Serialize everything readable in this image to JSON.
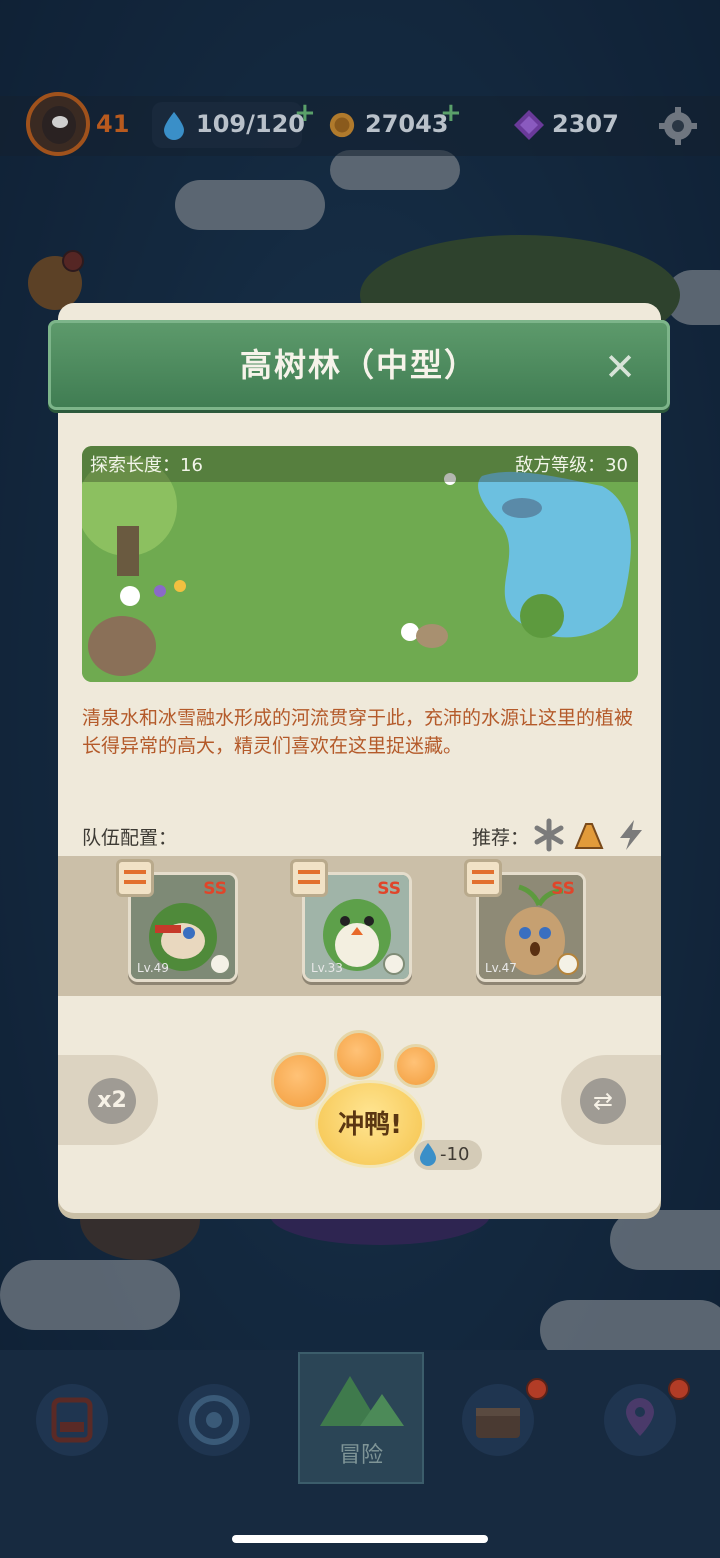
{
  "hud": {
    "level": "41",
    "energy": "109/120",
    "coins": "27043",
    "gems": "2307"
  },
  "modal": {
    "title": "高树林（中型）",
    "close": "✕",
    "explore_length": "探索长度：16",
    "enemy_level": "敌方等级：30",
    "description": "清泉水和冰雪融水形成的河流贯穿于此，充沛的水源让这里的植被长得异常的高大，精灵们喜欢在这里捉迷藏。",
    "team_label": "队伍配置：",
    "recommend_label": "推荐：",
    "team": [
      {
        "level": "Lv.49",
        "rank": "SS",
        "element": "leaf-icon"
      },
      {
        "level": "Lv.33",
        "rank": "SS",
        "element": "leaf-icon"
      },
      {
        "level": "Lv.47",
        "rank": "SS",
        "element": "rock-icon"
      }
    ],
    "speed": "x2",
    "go_label": "冲鸭!",
    "cost": "-10"
  },
  "nav": {
    "active_label": "冒险"
  },
  "colors": {
    "header_green": "#4f8b5f",
    "modal_bg": "#efe9da",
    "desc_text": "#b45a2a",
    "paw_orange": "#f29d3c"
  }
}
